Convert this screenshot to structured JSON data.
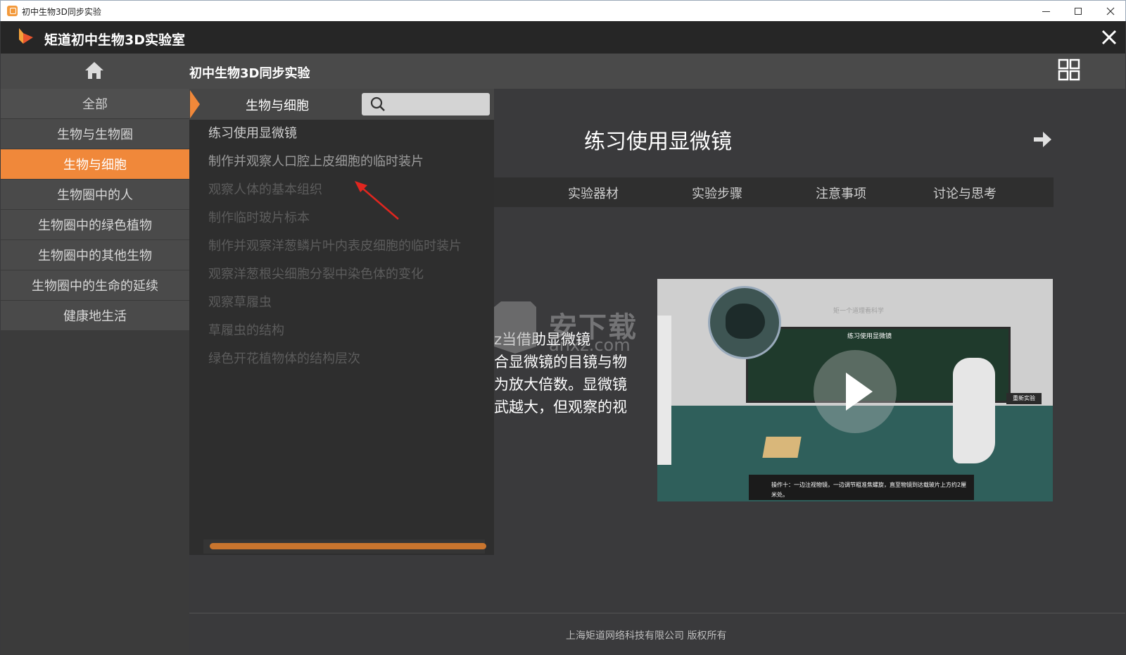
{
  "os": {
    "window_title": "初中生物3D同步实验",
    "min_icon": "minimize-icon",
    "max_icon": "maximize-icon",
    "close_icon": "close-icon"
  },
  "header": {
    "app_title": "矩道初中生物3D实验室",
    "logo_icon": "play-logo-icon",
    "close_icon": "close-icon"
  },
  "subheader": {
    "title": "初中生物3D同步实验",
    "home_icon": "home-icon",
    "grid_icon": "grid-icon"
  },
  "sidebar": {
    "items": [
      {
        "label": "全部"
      },
      {
        "label": "生物与生物圈"
      },
      {
        "label": "生物与细胞",
        "active": true
      },
      {
        "label": "生物圈中的人"
      },
      {
        "label": "生物圈中的绿色植物"
      },
      {
        "label": "生物圈中的其他生物"
      },
      {
        "label": "生物圈中的生命的延续"
      },
      {
        "label": "健康地生活"
      }
    ]
  },
  "dropdown": {
    "category": "生物与细胞",
    "search_placeholder": "",
    "items": [
      {
        "label": "练习使用显微镜"
      },
      {
        "label": "制作并观察人口腔上皮细胞的临时装片"
      },
      {
        "label": "观察人体的基本组织"
      },
      {
        "label": "制作临时玻片标本"
      },
      {
        "label": "制作并观察洋葱鳞片叶内表皮细胞的临时装片"
      },
      {
        "label": "观察洋葱根尖细胞分裂中染色体的变化"
      },
      {
        "label": "观察草履虫"
      },
      {
        "label": "草履虫的结构"
      },
      {
        "label": "绿色开花植物体的结构层次"
      }
    ]
  },
  "main": {
    "title": "练习使用显微镜",
    "tabs": [
      {
        "label": "实验器材"
      },
      {
        "label": "实验步骤"
      },
      {
        "label": "注意事项"
      },
      {
        "label": "讨论与思考"
      }
    ],
    "description_lines": [
      "z当借助显微镜",
      "合显微镜的目镜与物",
      "为放大倍数。显微镜",
      "武越大，但观察的视"
    ],
    "video": {
      "brand": "矩一个道理看科学",
      "board_title": "练习使用显微镜",
      "restart_label": "重新实验",
      "caption": "操作十：一边注视物镜，一边调节粗准焦螺旋，直至物镜到达载玻片上方约2厘米处。"
    }
  },
  "watermark": {
    "text": "安下载",
    "sub": "anxz.com"
  },
  "footer": {
    "text": "上海矩道网络科技有限公司 版权所有"
  },
  "colors": {
    "accent": "#f0883a",
    "header_bg": "#262626",
    "panel_bg": "#2e2e2e"
  }
}
